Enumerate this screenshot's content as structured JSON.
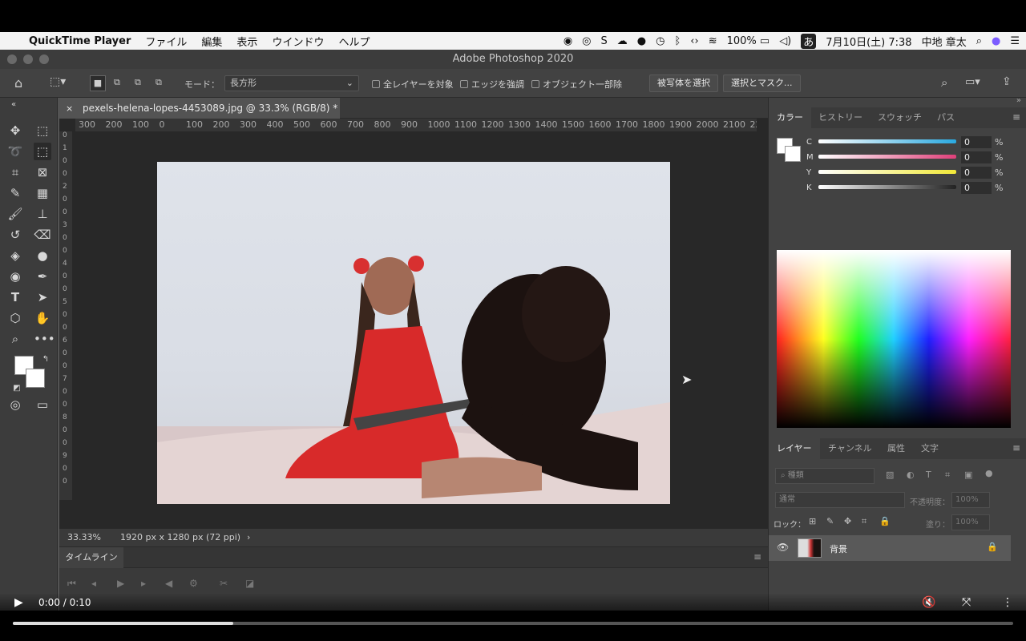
{
  "menubar": {
    "app_name": "QuickTime Player",
    "items": [
      "ファイル",
      "編集",
      "表示",
      "ウインドウ",
      "ヘルプ"
    ],
    "battery": "100%",
    "input_mode": "あ",
    "datetime": "7月10日(土)  7:38",
    "user": "中地 章太"
  },
  "window": {
    "title": "Adobe Photoshop 2020"
  },
  "options_bar": {
    "mode_label": "モード：",
    "mode_value": "長方形",
    "check_all_layers": "全レイヤーを対象",
    "check_enhance_edge": "エッジを強調",
    "check_object_subtract": "オブジェクト一部除",
    "select_subject": "被写体を選択",
    "select_and_mask": "選択とマスク..."
  },
  "document": {
    "tab_title": "pexels-helena-lopes-4453089.jpg @ 33.3% (RGB/8) *",
    "ruler_ticks": [
      "300",
      "200",
      "100",
      "0",
      "100",
      "200",
      "300",
      "400",
      "500",
      "600",
      "700",
      "800",
      "900",
      "1000",
      "1100",
      "1200",
      "1300",
      "1400",
      "1500",
      "1600",
      "1700",
      "1800",
      "1900",
      "2000",
      "2100",
      "22"
    ],
    "vruler_ticks": [
      "0",
      "1",
      "0",
      "0",
      "2",
      "0",
      "0",
      "3",
      "0",
      "0",
      "4",
      "0",
      "0",
      "5",
      "0",
      "0",
      "6",
      "0",
      "0",
      "7",
      "0",
      "0",
      "8",
      "0",
      "0",
      "9",
      "0",
      "0"
    ],
    "zoom": "33.33%",
    "dimensions": "1920 px x 1280 px (72 ppi)"
  },
  "timeline": {
    "tab": "タイムライン"
  },
  "color_panel": {
    "tabs": [
      "カラー",
      "ヒストリー",
      "スウォッチ",
      "パス"
    ],
    "channels": [
      {
        "label": "C",
        "value": "0",
        "color": "#2aa9e0"
      },
      {
        "label": "M",
        "value": "0",
        "color": "#e0407a"
      },
      {
        "label": "Y",
        "value": "0",
        "color": "#f1e838"
      },
      {
        "label": "K",
        "value": "0",
        "color": "#777777"
      }
    ],
    "unit": "%"
  },
  "layers_panel": {
    "tabs": [
      "レイヤー",
      "チャンネル",
      "属性",
      "文字"
    ],
    "filter_placeholder": "種類",
    "blend_mode": "通常",
    "opacity_label": "不透明度：",
    "opacity_value": "100%",
    "lock_label": "ロック：",
    "fill_label": "塗り：",
    "fill_value": "100%",
    "layers": [
      {
        "name": "背景",
        "visible": true,
        "locked": true
      }
    ]
  },
  "video": {
    "time": "0:00 / 0:10",
    "progress": 0.0
  }
}
